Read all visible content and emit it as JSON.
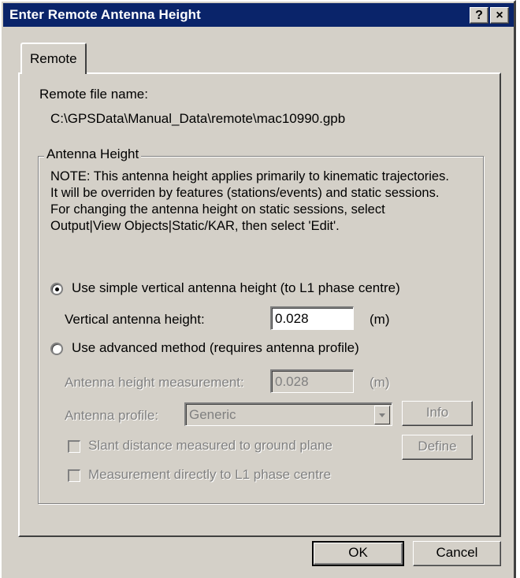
{
  "window": {
    "title": "Enter Remote Antenna Height",
    "help_glyph": "?",
    "close_glyph": "×"
  },
  "tabs": [
    {
      "label": "Remote"
    }
  ],
  "remote_file": {
    "label": "Remote file name:",
    "path": "C:\\GPSData\\Manual_Data\\remote\\mac10990.gpb"
  },
  "antenna_group": {
    "label": "Antenna Height",
    "note": "NOTE: This antenna height applies primarily to kinematic trajectories.\nIt will be overriden by features (stations/events) and static sessions.\nFor changing the antenna height on static sessions, select\nOutput|View Objects|Static/KAR, then select 'Edit'.",
    "simple": {
      "radio_label": "Use simple vertical antenna height (to L1 phase centre)",
      "selected": true,
      "field_label": "Vertical antenna height:",
      "value": "0.028",
      "unit": "(m)"
    },
    "advanced": {
      "radio_label": "Use advanced method (requires antenna profile)",
      "selected": false,
      "measurement_label": "Antenna height measurement:",
      "measurement_value": "0.028",
      "measurement_unit": "(m)",
      "profile_label": "Antenna profile:",
      "profile_value": "Generic",
      "info_button": "Info",
      "define_button": "Define",
      "slant_label": "Slant distance measured to ground plane",
      "direct_label": "Measurement directly to L1 phase centre"
    }
  },
  "buttons": {
    "ok": "OK",
    "cancel": "Cancel"
  }
}
